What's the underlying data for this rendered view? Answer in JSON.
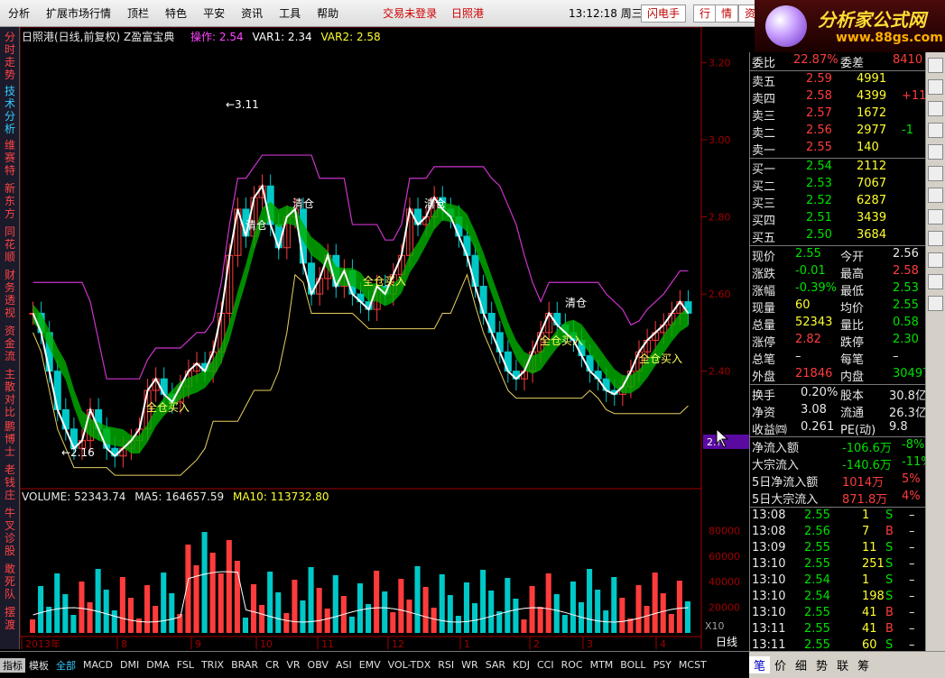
{
  "menu": {
    "items": [
      "分析",
      "扩展市场行情",
      "顶栏",
      "特色",
      "平安",
      "资讯",
      "工具",
      "帮助"
    ],
    "status": [
      "交易未登录",
      "日照港"
    ],
    "clock": "13:12:18 周三",
    "buttons": [
      "闪电手",
      "行",
      "情",
      "资"
    ]
  },
  "logo": {
    "title": "分析家公式网",
    "url": "www.88gs.com"
  },
  "left_tabs": [
    "分时走势",
    "技术分析",
    "维赛特",
    "新东方",
    "同花顺",
    "财务透视",
    "资金流",
    "主散对比",
    "鹏博士",
    "老钱庄",
    "牛叉诊股",
    "敢死队",
    "摆渡"
  ],
  "chart": {
    "title": "日照港(日线,前复权) Z盈富宝典",
    "indicator": {
      "label": "操作: 2.54",
      "var1": "VAR1: 2.34",
      "var2": "VAR2: 2.58"
    },
    "price_ticks": [
      "3.20",
      "3.00",
      "2.80",
      "2.60",
      "2.40"
    ],
    "annotations": {
      "high": "3.11",
      "low": "2.16",
      "qing": "清仓",
      "buy": "全仓买入",
      "mark": "2.?"
    },
    "volume": {
      "vol": "VOLUME: 52343.74",
      "ma5": "MA5: 164657.59",
      "ma10": "MA10: 113732.80"
    },
    "vol_ticks": [
      "80000",
      "60000",
      "40000",
      "20000"
    ],
    "vol_unit": "X10",
    "x_ticks": [
      "2013年",
      "8",
      "9",
      "10",
      "11",
      "12",
      "1",
      "2",
      "3",
      "4"
    ],
    "period": "日线"
  },
  "chart_data": {
    "type": "candlestick",
    "ylim": [
      2.1,
      3.25
    ],
    "close": [
      2.55,
      2.5,
      2.4,
      2.3,
      2.25,
      2.2,
      2.22,
      2.3,
      2.25,
      2.2,
      2.18,
      2.2,
      2.22,
      2.25,
      2.35,
      2.38,
      2.34,
      2.32,
      2.36,
      2.4,
      2.42,
      2.4,
      2.45,
      2.55,
      2.7,
      2.82,
      2.75,
      2.85,
      2.88,
      2.78,
      2.72,
      2.8,
      2.82,
      2.68,
      2.6,
      2.64,
      2.7,
      2.62,
      2.66,
      2.6,
      2.58,
      2.56,
      2.62,
      2.6,
      2.65,
      2.7,
      2.82,
      2.78,
      2.8,
      2.85,
      2.82,
      2.8,
      2.75,
      2.7,
      2.62,
      2.55,
      2.5,
      2.45,
      2.4,
      2.38,
      2.4,
      2.45,
      2.5,
      2.55,
      2.52,
      2.5,
      2.48,
      2.44,
      2.4,
      2.38,
      2.35,
      2.34,
      2.36,
      2.4,
      2.45,
      2.48,
      2.5,
      2.52,
      2.55,
      2.58,
      2.55
    ]
  },
  "quote": {
    "wei": {
      "k1": "委比",
      "v1": "22.87%",
      "k2": "委差",
      "v2": "8410"
    },
    "sells": [
      {
        "k": "卖五",
        "p": "2.59",
        "v": "4991",
        "c": ""
      },
      {
        "k": "卖四",
        "p": "2.58",
        "v": "4399",
        "c": "+11"
      },
      {
        "k": "卖三",
        "p": "2.57",
        "v": "1672",
        "c": ""
      },
      {
        "k": "卖二",
        "p": "2.56",
        "v": "2977",
        "c": "-1"
      },
      {
        "k": "卖一",
        "p": "2.55",
        "v": "140",
        "c": ""
      }
    ],
    "buys": [
      {
        "k": "买一",
        "p": "2.54",
        "v": "2112"
      },
      {
        "k": "买二",
        "p": "2.53",
        "v": "7067"
      },
      {
        "k": "买三",
        "p": "2.52",
        "v": "6287"
      },
      {
        "k": "买四",
        "p": "2.51",
        "v": "3439"
      },
      {
        "k": "买五",
        "p": "2.50",
        "v": "3684"
      }
    ],
    "stats": [
      {
        "k1": "现价",
        "v1": "2.55",
        "c1": "green",
        "k2": "今开",
        "v2": "2.56",
        "c2": "white"
      },
      {
        "k1": "涨跌",
        "v1": "-0.01",
        "c1": "green",
        "k2": "最高",
        "v2": "2.58",
        "c2": "red"
      },
      {
        "k1": "涨幅",
        "v1": "-0.39%",
        "c1": "green",
        "k2": "最低",
        "v2": "2.53",
        "c2": "green"
      },
      {
        "k1": "现量",
        "v1": "60",
        "c1": "yellow",
        "k2": "均价",
        "v2": "2.55",
        "c2": "green"
      },
      {
        "k1": "总量",
        "v1": "52343",
        "c1": "yellow",
        "k2": "量比",
        "v2": "0.58",
        "c2": "green"
      },
      {
        "k1": "涨停",
        "v1": "2.82",
        "c1": "red",
        "k2": "跌停",
        "v2": "2.30",
        "c2": "green"
      },
      {
        "k1": "总笔",
        "v1": "–",
        "c1": "white",
        "k2": "每笔",
        "v2": "–",
        "c2": "white"
      },
      {
        "k1": "外盘",
        "v1": "21846",
        "c1": "red",
        "k2": "内盘",
        "v2": "30497",
        "c2": "green"
      }
    ],
    "fin": [
      {
        "k1": "换手",
        "v1": "0.20%",
        "k2": "股本",
        "v2": "30.8亿"
      },
      {
        "k1": "净资",
        "v1": "3.08",
        "k2": "流通",
        "v2": "26.3亿"
      },
      {
        "k1": "收益㈣",
        "v1": "0.261",
        "k2": "PE(动)",
        "v2": "9.8"
      }
    ],
    "flow": [
      {
        "k": "净流入额",
        "v": "-106.6万",
        "p": "-8%",
        "c": "green"
      },
      {
        "k": "大宗流入",
        "v": "-140.6万",
        "p": "-11%",
        "c": "green"
      },
      {
        "k": "5日净流入额",
        "v": "1014万",
        "p": "5%",
        "c": "red"
      },
      {
        "k": "5日大宗流入",
        "v": "871.8万",
        "p": "4%",
        "c": "red"
      }
    ],
    "ticks": [
      {
        "t": "13:08",
        "p": "2.55",
        "v": "1",
        "s": "S"
      },
      {
        "t": "13:08",
        "p": "2.56",
        "v": "7",
        "s": "B"
      },
      {
        "t": "13:09",
        "p": "2.55",
        "v": "11",
        "s": "S"
      },
      {
        "t": "13:10",
        "p": "2.55",
        "v": "251",
        "s": "S"
      },
      {
        "t": "13:10",
        "p": "2.54",
        "v": "1",
        "s": "S"
      },
      {
        "t": "13:10",
        "p": "2.54",
        "v": "198",
        "s": "S"
      },
      {
        "t": "13:10",
        "p": "2.55",
        "v": "41",
        "s": "B"
      },
      {
        "t": "13:11",
        "p": "2.55",
        "v": "41",
        "s": "B"
      },
      {
        "t": "13:11",
        "p": "2.55",
        "v": "60",
        "s": "S"
      }
    ],
    "tick_dash": "–"
  },
  "bottom_tabs": [
    "指标",
    "模板",
    "全部",
    "MACD",
    "DMI",
    "DMA",
    "FSL",
    "TRIX",
    "BRAR",
    "CR",
    "VR",
    "OBV",
    "ASI",
    "EMV",
    "VOL-TDX",
    "RSI",
    "WR",
    "SAR",
    "KDJ",
    "CCI",
    "ROC",
    "MTM",
    "BOLL",
    "PSY",
    "MCST"
  ],
  "right_bottom_tabs": [
    "笔",
    "价",
    "细",
    "势",
    "联",
    "筹"
  ],
  "icons": [
    "tree",
    "vol",
    "kline",
    "pie",
    "bar",
    "F10",
    "info",
    "star",
    "grid",
    "RS",
    "chart",
    "hand"
  ]
}
